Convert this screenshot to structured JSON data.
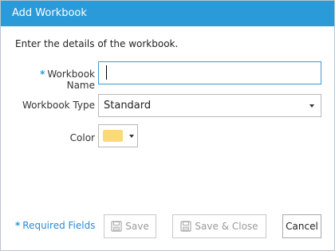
{
  "dialog": {
    "title": "Add Workbook",
    "intro": "Enter the details of the workbook."
  },
  "form": {
    "required_marker": "*",
    "workbook_name": {
      "label": "Workbook Name",
      "value": "",
      "required": true
    },
    "workbook_type": {
      "label": "Workbook Type",
      "selected": "Standard"
    },
    "color": {
      "label": "Color",
      "selected_hex": "#ffd978"
    }
  },
  "footer": {
    "required_marker": "*",
    "required_note": "Required Fields",
    "save_label": "Save",
    "save_close_label": "Save & Close",
    "cancel_label": "Cancel"
  },
  "icons": {
    "save": "floppy-disk-icon",
    "save_close": "floppy-disk-icon",
    "dropdown": "chevron-down-icon"
  },
  "colors": {
    "titlebar": "#2b9ad8",
    "accent": "#2b8ad0"
  }
}
